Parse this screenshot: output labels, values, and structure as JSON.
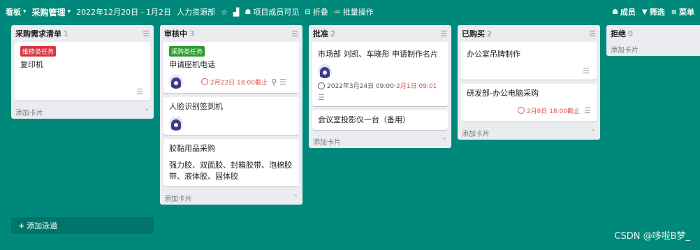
{
  "topbar": {
    "view_label": "看板",
    "board_name": "采购管理",
    "date_range": "2022年12月20日 - 1月2日",
    "department": "人力资源部",
    "visibility": "项目成员可见",
    "collapse": "折叠",
    "batch": "批量操作",
    "members": "成员",
    "filter": "筛选",
    "menu": "菜单"
  },
  "icons": {
    "chevron": "chevron-down-icon",
    "star": "star-icon",
    "chart": "chart-icon",
    "members": "members-icon",
    "collapse": "collapse-icon",
    "batch": "list-icon",
    "filter": "filter-icon",
    "menu": "hamburger-icon"
  },
  "colors": {
    "background": "#00897b",
    "tag_repair": "#d9363e",
    "tag_purchase": "#2d9c2d",
    "due": "#d9534f"
  },
  "lists": [
    {
      "title": "采购需求清单",
      "count": "1",
      "add_card": "添加卡片",
      "cards": [
        {
          "tag": "维修类任务",
          "title": "复印机"
        }
      ]
    },
    {
      "title": "审核中",
      "count": "3",
      "add_card": "添加卡片",
      "cards": [
        {
          "tag": "采购类任务",
          "title": "申请座机电话",
          "due": "2月22日 18:00截止"
        },
        {
          "title": "人脸识别签到机"
        },
        {
          "title": "胶黏用品采购",
          "desc": "强力胶、双面胶、封箱胶带、泡棉胶带、液体胶、固体胶"
        }
      ]
    },
    {
      "title": "批准",
      "count": "2",
      "add_card": "添加卡片",
      "cards": [
        {
          "title": "市场部 刘凯、车晓彤 申请制作名片",
          "range_start": "2022年3月24日 09:00",
          "range_sep": " - ",
          "range_end": "2月1日 09:01"
        },
        {
          "title": "会议室投影仪一台（备用）"
        }
      ]
    },
    {
      "title": "已购买",
      "count": "2",
      "add_card": "添加卡片",
      "cards": [
        {
          "title": "办公室吊牌制作"
        },
        {
          "title": "研发部-办公电脑采购",
          "due": "2月8日 18:00截止"
        }
      ]
    },
    {
      "title": "拒绝",
      "count": "0",
      "add_card": "添加卡片",
      "cards": []
    }
  ],
  "add_lane": "添加泳道",
  "watermark": "CSDN @哆啦B梦_"
}
